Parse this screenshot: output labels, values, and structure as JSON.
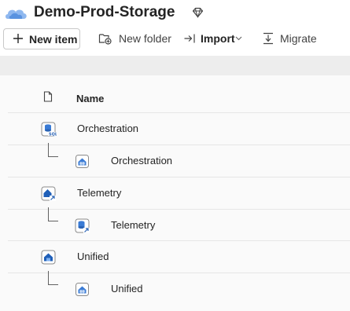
{
  "header": {
    "title": "Demo-Prod-Storage"
  },
  "toolbar": {
    "new_item": "New item",
    "new_folder": "New folder",
    "import": "Import",
    "migrate": "Migrate"
  },
  "table": {
    "name_header": "Name",
    "rows": [
      {
        "label": "Orchestration",
        "icon": "sql-database-icon",
        "child": false
      },
      {
        "label": "Orchestration",
        "icon": "warehouse-icon",
        "child": true
      },
      {
        "label": "Telemetry",
        "icon": "lakehouse-shortcut-icon",
        "child": false
      },
      {
        "label": "Telemetry",
        "icon": "database-shortcut-icon",
        "child": true
      },
      {
        "label": "Unified",
        "icon": "lakehouse-icon",
        "child": false
      },
      {
        "label": "Unified",
        "icon": "warehouse-icon",
        "child": true
      }
    ]
  }
}
